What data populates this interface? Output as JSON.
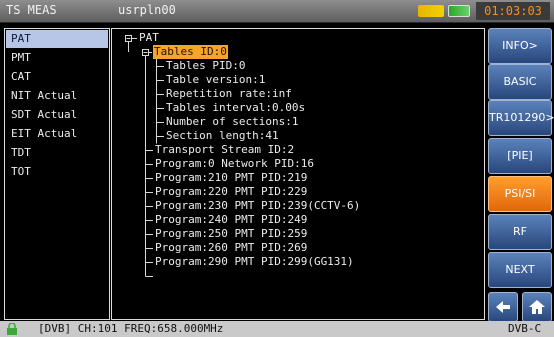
{
  "header": {
    "mode": "TS MEAS",
    "file": "usrpln00",
    "time": "01:03:03"
  },
  "colors": {
    "accent_orange": "#ff8a1c",
    "button_blue": "#3f66a3",
    "selected_blue": "#b7c6e6",
    "highlight_orange": "#f5a52a"
  },
  "icons": {
    "status": [
      "signal-icon",
      "battery-icon"
    ],
    "back": "arrow-left-icon",
    "home": "home-icon",
    "lock": "lock-icon"
  },
  "sidebar": {
    "items": [
      {
        "label": "PAT"
      },
      {
        "label": "PMT"
      },
      {
        "label": "CAT"
      },
      {
        "label": "NIT Actual"
      },
      {
        "label": "SDT Actual"
      },
      {
        "label": "EIT Actual"
      },
      {
        "label": "TDT"
      },
      {
        "label": "TOT"
      }
    ],
    "selected": "PAT"
  },
  "tree": {
    "root": "PAT",
    "table": "Tables ID:0",
    "table_fields": [
      "Tables PID:0",
      "Table version:1",
      "Repetition rate:inf",
      "Tables interval:0.00s",
      "Number of sections:1",
      "Section length:41"
    ],
    "entries": [
      "Transport Stream ID:2",
      "Program:0 Network PID:16",
      "Program:210 PMT PID:219",
      "Program:220 PMT PID:229",
      "Program:230 PMT PID:239(CCTV-6)",
      "Program:240 PMT PID:249",
      "Program:250 PMT PID:259",
      "Program:260 PMT PID:269",
      "Program:290 PMT PID:299(GG131)"
    ]
  },
  "buttons": [
    {
      "label": "INFO>",
      "active": false
    },
    {
      "label": "BASIC",
      "active": false
    },
    {
      "label": "TR101290>",
      "active": false
    },
    {
      "label": "[PIE]",
      "active": false
    },
    {
      "label": "PSI/SI",
      "active": true
    },
    {
      "label": "RF",
      "active": false
    },
    {
      "label": "NEXT",
      "active": false
    }
  ],
  "status_bar": {
    "channel": "[DVB] CH:101 FREQ:658.000MHz",
    "standard": "DVB-C"
  }
}
